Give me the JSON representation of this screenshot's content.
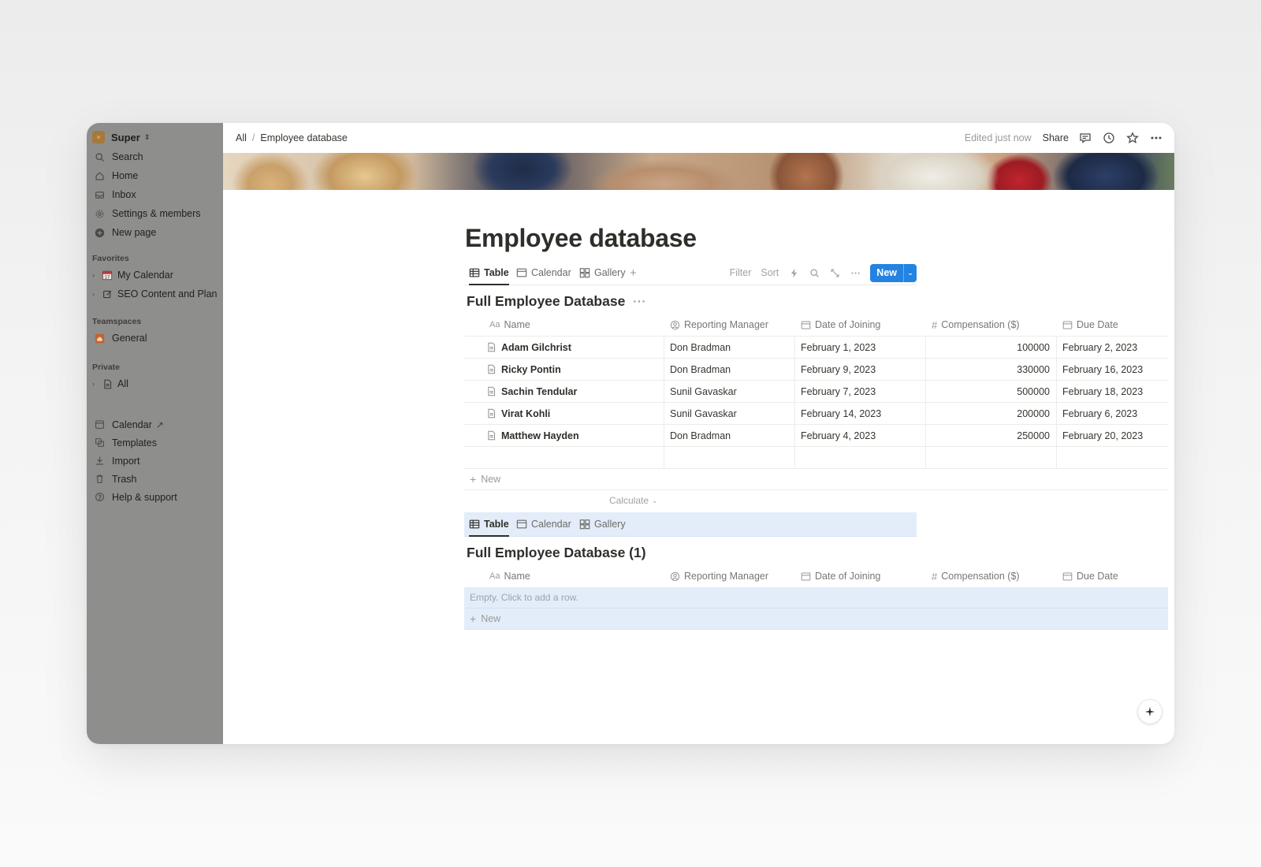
{
  "sidebar": {
    "workspace": "Super",
    "nav": [
      {
        "label": "Search",
        "icon": "search-icon"
      },
      {
        "label": "Home",
        "icon": "home-icon"
      },
      {
        "label": "Inbox",
        "icon": "inbox-icon"
      },
      {
        "label": "Settings & members",
        "icon": "gear-icon"
      },
      {
        "label": "New page",
        "icon": "plus-circle-icon"
      }
    ],
    "favorites_label": "Favorites",
    "favorites": [
      {
        "label": "My Calendar",
        "icon": "calendar-emoji-icon"
      },
      {
        "label": "SEO Content and Plan",
        "icon": "edit-icon"
      }
    ],
    "teamspaces_label": "Teamspaces",
    "teamspaces": [
      {
        "label": "General",
        "icon": "house-icon"
      }
    ],
    "private_label": "Private",
    "private": [
      {
        "label": "All",
        "icon": "page-icon"
      }
    ],
    "bottom": [
      {
        "label": "Calendar",
        "icon": "calendar-icon",
        "suffix": "↗"
      },
      {
        "label": "Templates",
        "icon": "templates-icon"
      },
      {
        "label": "Import",
        "icon": "import-icon"
      },
      {
        "label": "Trash",
        "icon": "trash-icon"
      },
      {
        "label": "Help & support",
        "icon": "help-icon"
      }
    ]
  },
  "topbar": {
    "breadcrumbs": [
      "All",
      "Employee database"
    ],
    "edited": "Edited just now",
    "share": "Share"
  },
  "page": {
    "title": "Employee database"
  },
  "db1": {
    "tabs": [
      "Table",
      "Calendar",
      "Gallery"
    ],
    "tools": {
      "filter": "Filter",
      "sort": "Sort",
      "new": "New"
    },
    "title": "Full Employee Database",
    "more": "···",
    "columns": [
      "Name",
      "Reporting Manager",
      "Date of Joining",
      "Compensation ($)",
      "Due Date"
    ],
    "rows": [
      [
        "Adam Gilchrist",
        "Don Bradman",
        "February 1, 2023",
        "100000",
        "February 2, 2023"
      ],
      [
        "Ricky Pontin",
        "Don Bradman",
        "February 9, 2023",
        "330000",
        "February 16, 2023"
      ],
      [
        "Sachin Tendular",
        "Sunil Gavaskar",
        "February 7, 2023",
        "500000",
        "February 18, 2023"
      ],
      [
        "Virat Kohli",
        "Sunil Gavaskar",
        "February 14, 2023",
        "200000",
        "February 6, 2023"
      ],
      [
        "Matthew Hayden",
        "Don Bradman",
        "February 4, 2023",
        "250000",
        "February 20, 2023"
      ]
    ],
    "new_label": "New",
    "calculate": "Calculate"
  },
  "db2": {
    "tabs": [
      "Table",
      "Calendar",
      "Gallery"
    ],
    "title": "Full Employee Database (1)",
    "columns": [
      "Name",
      "Reporting Manager",
      "Date of Joining",
      "Compensation ($)",
      "Due Date"
    ],
    "empty": "Empty. Click to add a row.",
    "new_label": "New"
  },
  "colors": {
    "accent": "#2383e2",
    "highlight": "#e3edf9",
    "sidebar": "#8e8e8d"
  }
}
